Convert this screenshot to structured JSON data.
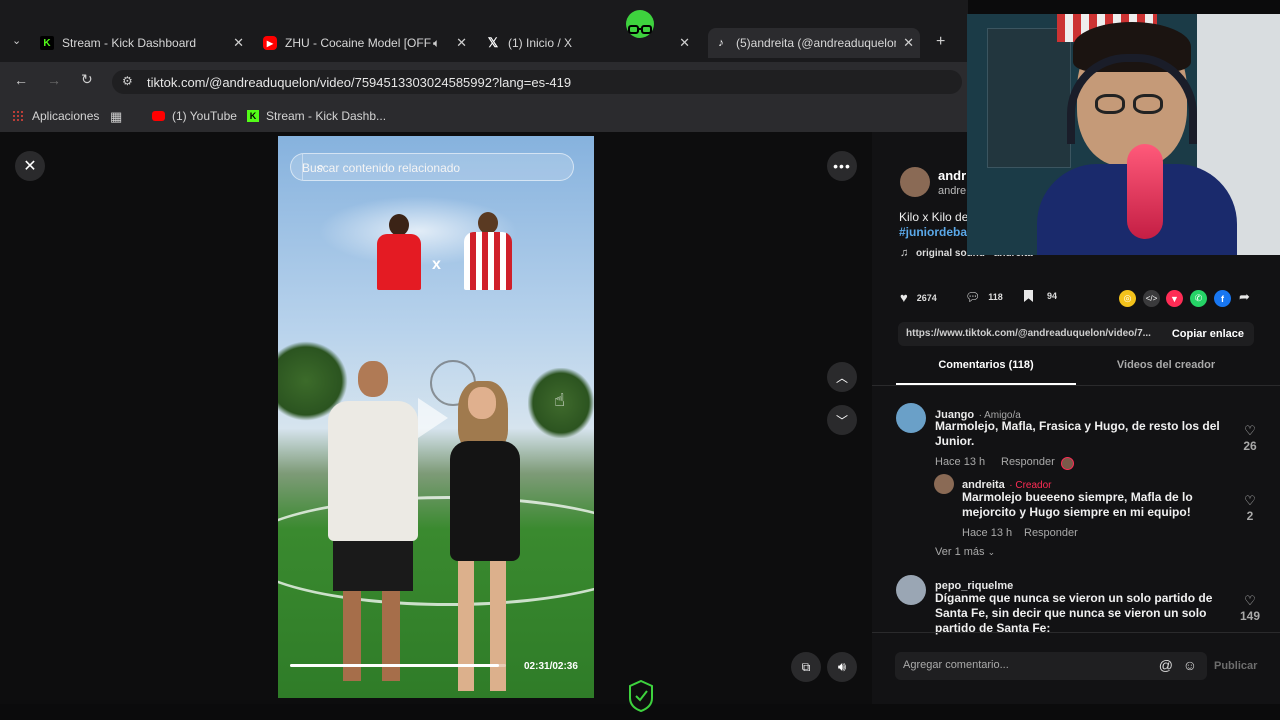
{
  "tabs": [
    {
      "label": "Stream - Kick Dashboard",
      "icon": "kick-icon"
    },
    {
      "label": "ZHU - Cocaine Model [OFF",
      "icon": "youtube-icon"
    },
    {
      "label": "(1) Inicio / X",
      "icon": "x-icon"
    },
    {
      "label": "(5)andreita (@andreaduquelon)",
      "icon": "tiktok-icon"
    }
  ],
  "address": {
    "url": "tiktok.com/@andreaduquelon/video/7594513303024585992?lang=es-419"
  },
  "bookmarks": [
    {
      "label": "Aplicaciones"
    },
    {
      "label": "(1) YouTube"
    },
    {
      "label": "Stream - Kick Dashb..."
    }
  ],
  "video": {
    "search_placeholder": "Buscar contenido relacionado",
    "time": "02:31/02:36",
    "progress": 0.968,
    "vs_label": "x"
  },
  "post": {
    "username": "andr",
    "handle": "andre",
    "caption": "Kilo x Kilo de",
    "hashtag": "#juniordeba",
    "sound": "original sound - andreita",
    "likes": "2674",
    "comments": "118",
    "saves": "94",
    "link": "https://www.tiktok.com/@andreaduquelon/video/7...",
    "copy_label": "Copiar enlace"
  },
  "tabs_panel": {
    "comments_tab": "Comentarios (118)",
    "creator_tab": "Videos del creador"
  },
  "comments": [
    {
      "name": "Juango",
      "badge": "· Amigo/a",
      "text1": "Marmolejo, Mafla, Frasica y Hugo, de resto los del",
      "text2": "Junior.",
      "time": "Hace 13 h",
      "reply": "Responder",
      "likes": "26"
    },
    {
      "name": "andreita",
      "badge": "· Creador",
      "text1": "Marmolejo bueeeno siempre, Mafla de lo",
      "text2": "mejorcito y Hugo siempre en mi equipo!",
      "time": "Hace 13 h",
      "reply": "Responder",
      "likes": "2"
    },
    {
      "name": "pepo_riquelme",
      "badge": "",
      "text1": "Díganme que nunca se vieron un solo partido de",
      "text2": "Santa Fe, sin decir que nunca se vieron un solo",
      "text3": "partido de Santa Fe:",
      "likes": "149"
    }
  ],
  "more_replies": "Ver 1 más",
  "composer": {
    "placeholder": "Agregar comentario...",
    "post_label": "Publicar"
  },
  "colors": {
    "kick": "#53fc18",
    "youtube": "#ff0000",
    "creator": "#fe2c55",
    "accent_tab": "#ffffff"
  }
}
